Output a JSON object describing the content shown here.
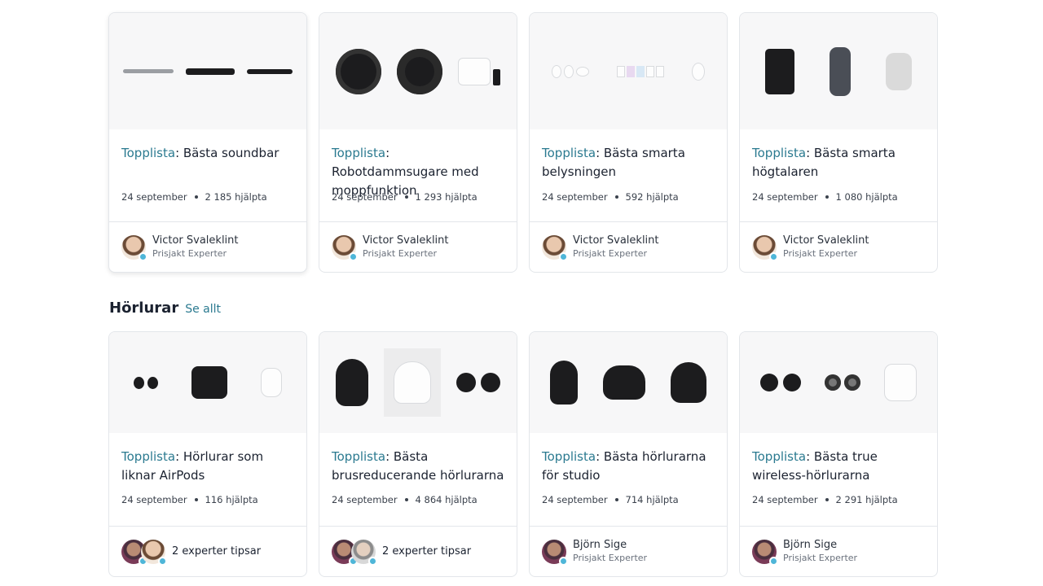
{
  "top_row": [
    {
      "lead": "Topplista",
      "rest": ": Bästa soundbar",
      "date": "24 september",
      "helpful": "2 185 hjälpta",
      "author_name": "Victor Svaleklint",
      "author_role": "Prisjakt Experter",
      "products": [
        "soundbar-icon",
        "soundbar-icon",
        "soundbar-icon"
      ]
    },
    {
      "lead": "Topplista",
      "rest": ": Robotdammsugare med moppfunktion",
      "date": "24 september",
      "helpful": "1 293 hjälpta",
      "author_name": "Victor Svaleklint",
      "author_role": "Prisjakt Experter",
      "products": [
        "robot-vacuum-icon",
        "robot-vacuum-icon",
        "robot-mop-icon"
      ]
    },
    {
      "lead": "Topplista",
      "rest": ": Bästa smarta belysningen",
      "date": "24 september",
      "helpful": "592 hjälpta",
      "author_name": "Victor Svaleklint",
      "author_role": "Prisjakt Experter",
      "products": [
        "smart-bulbs-icon",
        "light-strip-icon",
        "bulb-icon"
      ]
    },
    {
      "lead": "Topplista",
      "rest": ": Bästa smarta högtalaren",
      "date": "24 september",
      "helpful": "1 080 hjälpta",
      "author_name": "Victor Svaleklint",
      "author_role": "Prisjakt Experter",
      "products": [
        "speaker-icon",
        "speaker-icon",
        "speaker-icon"
      ]
    }
  ],
  "section": {
    "title": "Hörlurar",
    "see_all": "Se allt"
  },
  "bottom_row": [
    {
      "lead": "Topplista",
      "rest": ": Hörlurar som liknar AirPods",
      "date": "24 september",
      "helpful": "116 hjälpta",
      "tips": "2 experter tipsar",
      "products": [
        "earbuds-icon",
        "earbuds-case-icon",
        "earbuds-icon"
      ]
    },
    {
      "lead": "Topplista",
      "rest": ": Bästa brusreducerande hörlurarna",
      "date": "24 september",
      "helpful": "4 864 hjälpta",
      "tips": "2 experter tipsar",
      "products": [
        "headphones-icon",
        "headphones-icon",
        "earbuds-icon"
      ]
    },
    {
      "lead": "Topplista",
      "rest": ": Bästa hörlurarna för studio",
      "date": "24 september",
      "helpful": "714 hjälpta",
      "author_name": "Björn Sige",
      "author_role": "Prisjakt Experter",
      "products": [
        "headphones-icon",
        "headphones-icon",
        "headphones-icon"
      ]
    },
    {
      "lead": "Topplista",
      "rest": ": Bästa true wireless-hörlurarna",
      "date": "24 september",
      "helpful": "2 291 hjälpta",
      "author_name": "Björn Sige",
      "author_role": "Prisjakt Experter",
      "products": [
        "earbuds-icon",
        "earbuds-icon",
        "airpods-case-icon"
      ]
    }
  ],
  "colors": {
    "accent": "#2b7a90",
    "text": "#1b2230",
    "badge": "#4fb6d8"
  }
}
